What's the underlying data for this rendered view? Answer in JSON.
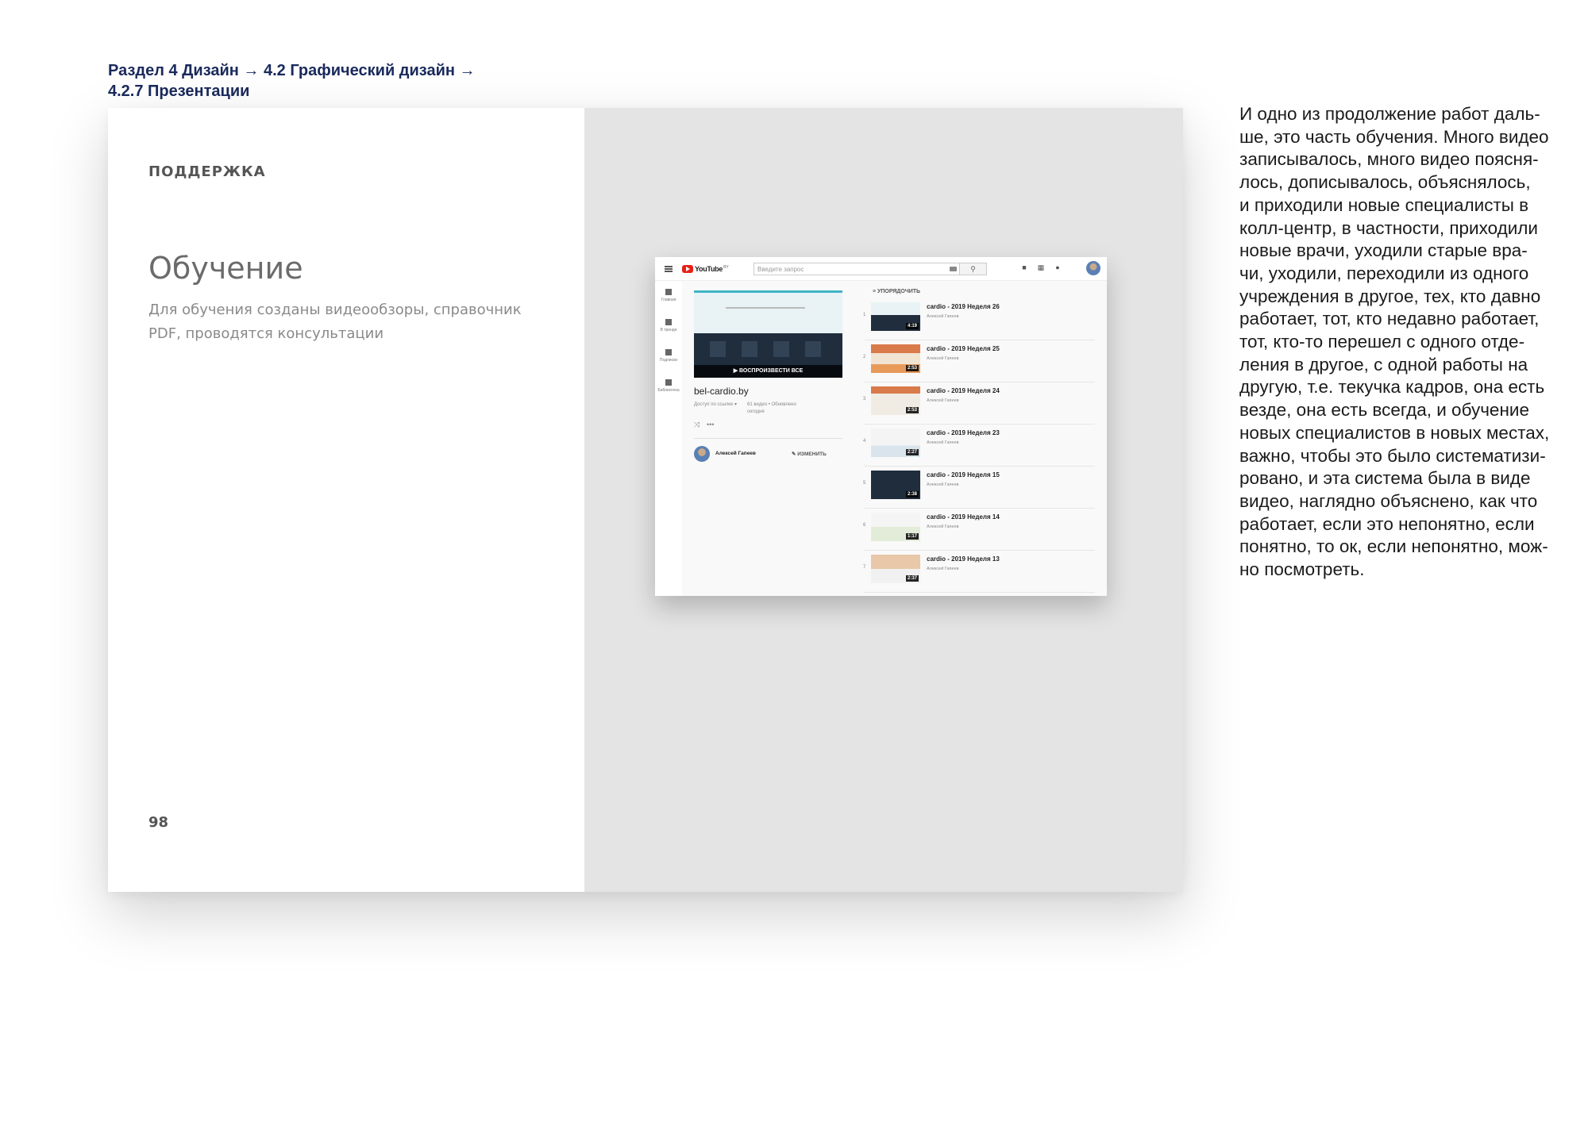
{
  "breadcrumb": {
    "line1": "Раздел 4 Дизайн  → 4.2 Графический дизайн →",
    "line2": "4.2.7 Презентации"
  },
  "left_page": {
    "kicker": "ПОДДЕРЖКА",
    "title": "Обучение",
    "description": "Для обучения созданы видеообзоры, справочник PDF, проводятся консультации",
    "page_number": "98"
  },
  "body_text": [
    "И одно из продолжение работ даль-",
    "ше, это часть обучения. Много видео",
    "записывалось, много видео поясня-",
    "лось, дописывалось, объяснялось,",
    "и приходили новые специалисты в",
    "колл-центр, в частности, приходили",
    "новые врачи, уходили старые вра-",
    "чи, уходили, переходили из одного",
    "учреждения в другое, тех, кто давно",
    "работает, тот, кто недавно работает,",
    "тот, кто-то перешел с одного отде-",
    "ления в другое, с одной работы на",
    "другую, т.е. текучка кадров, она есть",
    "везде, она есть всегда, и обучение",
    "новых специалистов в новых местах,",
    "важно, чтобы это было систематизи-",
    "ровано, и эта система была в виде",
    "видео, наглядно объяснено, как что",
    "работает, если это непонятно, если",
    "понятно, то ок, если непонятно, мож-",
    "но посмотреть."
  ],
  "youtube": {
    "logo": "YouTube",
    "logo_region": "BY",
    "search_placeholder": "Введите запрос",
    "sidebar": [
      "Главная",
      "В тренде",
      "Подписки",
      "Библиотека"
    ],
    "playlist": {
      "play_all": "▶  ВОСПРОИЗВЕСТИ ВСЕ",
      "title": "bel-cardio.by",
      "access": "Доступ по ссылке  ▾",
      "stats": "61 видео • Обновлено сегодня",
      "owner": "Алексей Гапеев",
      "edit": "✎  ИЗМЕНИТЬ"
    },
    "sort_label": "≡  УПОРЯДОЧИТЬ",
    "videos": [
      {
        "index": "1",
        "title": "cardio - 2019 Неделя 26",
        "author": "Алексей Гапеев",
        "duration": "4:19"
      },
      {
        "index": "2",
        "title": "cardio - 2019 Неделя 25",
        "author": "Алексей Гапеев",
        "duration": "2:53"
      },
      {
        "index": "3",
        "title": "cardio - 2019 Неделя 24",
        "author": "Алексей Гапеев",
        "duration": "2:53"
      },
      {
        "index": "4",
        "title": "cardio - 2019 Неделя 23",
        "author": "Алексей Гапеев",
        "duration": "2:27"
      },
      {
        "index": "5",
        "title": "cardio - 2019 Неделя 15",
        "author": "Алексей Гапеев",
        "duration": "2:38"
      },
      {
        "index": "6",
        "title": "cardio - 2019 Неделя 14",
        "author": "Алексей Гапеев",
        "duration": "1:17"
      },
      {
        "index": "7",
        "title": "cardio - 2019 Неделя 13",
        "author": "Алексей Гапеев",
        "duration": "2:37"
      }
    ]
  }
}
